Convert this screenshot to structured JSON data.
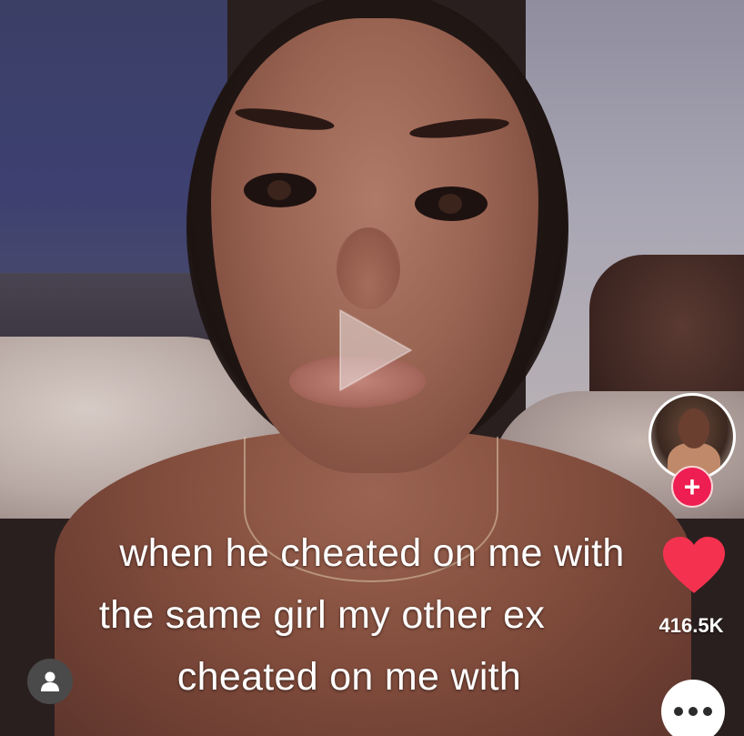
{
  "caption": {
    "line1": "when he cheated on me with",
    "line2": "the same girl my other ex",
    "line3": "cheated on me with"
  },
  "right_rail": {
    "follow_label": "+",
    "likes": "416.5K"
  },
  "icons": {
    "play": "play-icon",
    "like": "heart-icon",
    "more": "more-dots-icon",
    "profile": "person-icon",
    "follow": "plus-icon"
  },
  "colors": {
    "accent_red": "#ee1d52",
    "heart_red": "#f4324f",
    "caption_text": "#ffffff"
  }
}
